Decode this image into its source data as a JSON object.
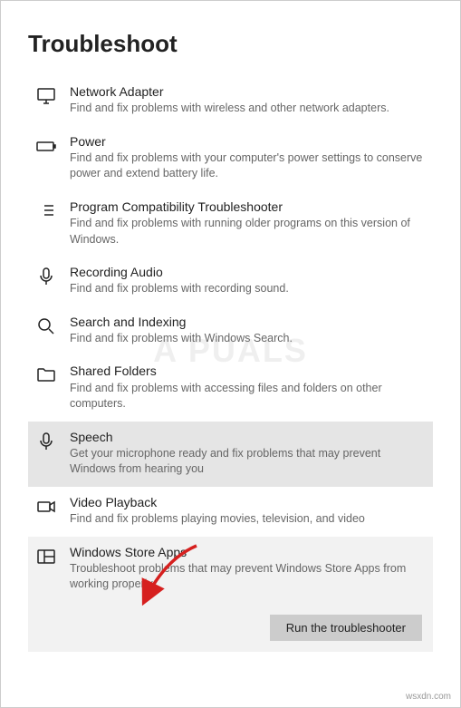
{
  "page_title": "Troubleshoot",
  "items": [
    {
      "key": "network-adapter",
      "title": "Network Adapter",
      "desc": "Find and fix problems with wireless and other network adapters."
    },
    {
      "key": "power",
      "title": "Power",
      "desc": "Find and fix problems with your computer's power settings to conserve power and extend battery life."
    },
    {
      "key": "program-compatibility",
      "title": "Program Compatibility Troubleshooter",
      "desc": "Find and fix problems with running older programs on this version of Windows."
    },
    {
      "key": "recording-audio",
      "title": "Recording Audio",
      "desc": "Find and fix problems with recording sound."
    },
    {
      "key": "search-indexing",
      "title": "Search and Indexing",
      "desc": "Find and fix problems with Windows Search."
    },
    {
      "key": "shared-folders",
      "title": "Shared Folders",
      "desc": "Find and fix problems with accessing files and folders on other computers."
    },
    {
      "key": "speech",
      "title": "Speech",
      "desc": "Get your microphone ready and fix problems that may prevent Windows from hearing you"
    },
    {
      "key": "video-playback",
      "title": "Video Playback",
      "desc": "Find and fix problems playing movies, television, and video"
    },
    {
      "key": "windows-store-apps",
      "title": "Windows Store Apps",
      "desc": "Troubleshoot problems that may prevent Windows Store Apps from working properly"
    }
  ],
  "run_button_label": "Run the troubleshooter",
  "watermark_text": "A  PUALS",
  "attribution": "wsxdn.com"
}
